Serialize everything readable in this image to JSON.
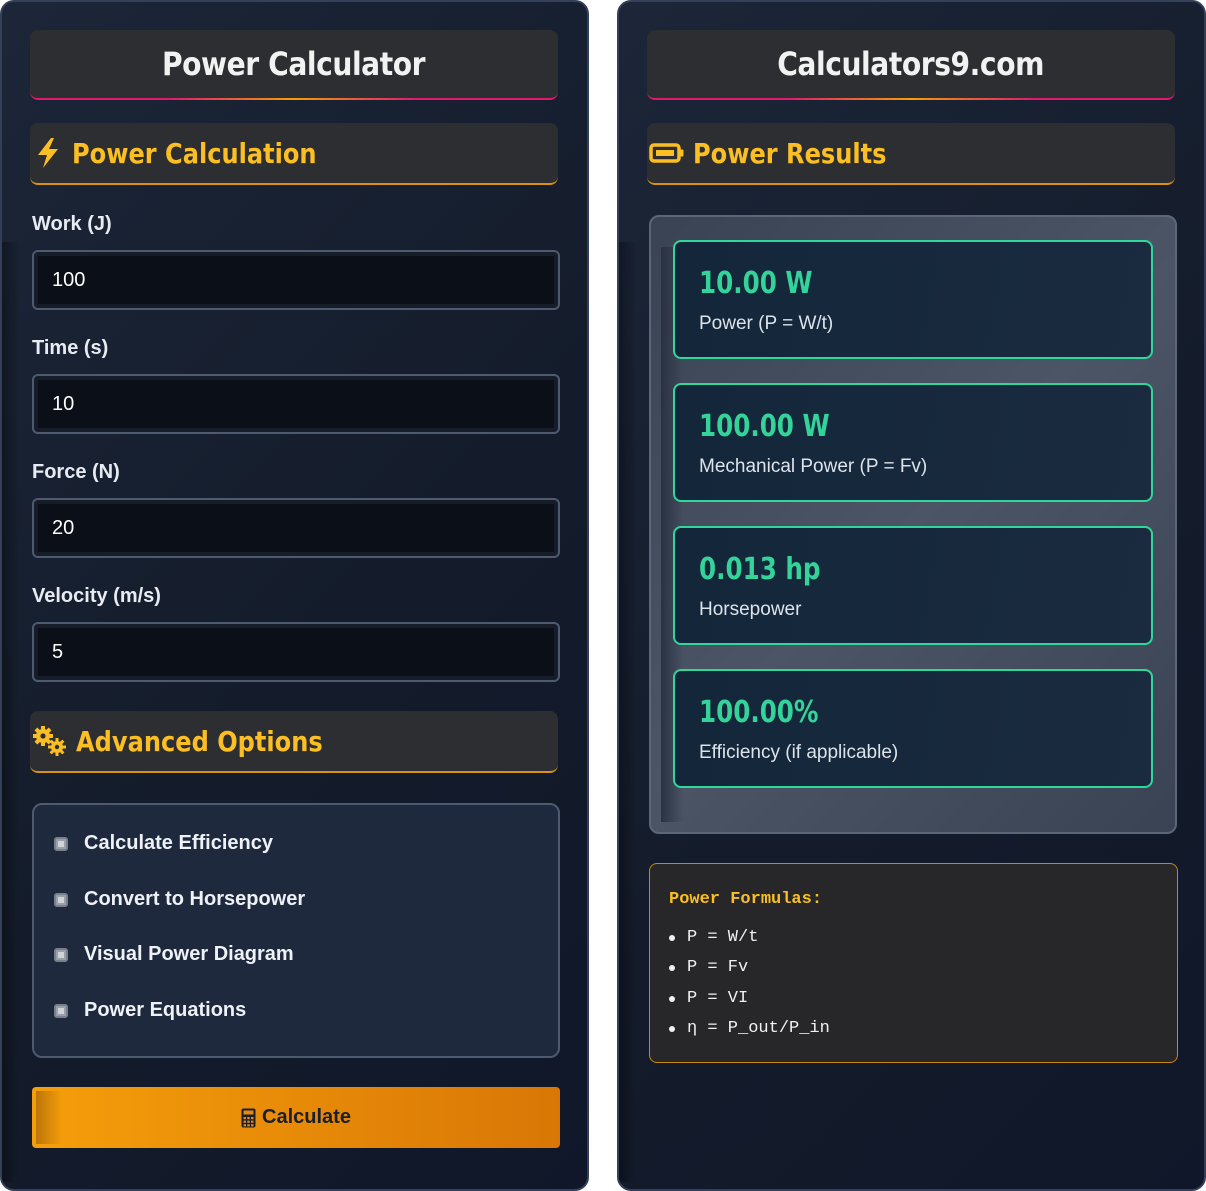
{
  "left": {
    "title": "Power Calculator",
    "calc_section": {
      "icon": "lightning-icon",
      "label": "Power Calculation"
    },
    "fields": [
      {
        "label": "Work (J)",
        "value": "100"
      },
      {
        "label": "Time (s)",
        "value": "10"
      },
      {
        "label": "Force (N)",
        "value": "20"
      },
      {
        "label": "Velocity (m/s)",
        "value": "5"
      }
    ],
    "advanced_section": {
      "icon": "gears-icon",
      "label": "Advanced Options"
    },
    "options": [
      {
        "label": "Calculate Efficiency"
      },
      {
        "label": "Convert to Horsepower"
      },
      {
        "label": "Visual Power Diagram"
      },
      {
        "label": "Power Equations"
      }
    ],
    "calculate_button": {
      "icon": "calculator-icon",
      "label": "Calculate"
    }
  },
  "right": {
    "title": "Calculators9.com",
    "results_section": {
      "icon": "battery-icon",
      "label": "Power Results"
    },
    "results": [
      {
        "value": "10.00 W",
        "label": "Power (P = W/t)"
      },
      {
        "value": "100.00 W",
        "label": "Mechanical Power (P = Fv)"
      },
      {
        "value": "0.013 hp",
        "label": "Horsepower"
      },
      {
        "value": "100.00%",
        "label": "Efficiency (if applicable)"
      }
    ],
    "formulas": {
      "title": "Power Formulas:",
      "items": [
        "P = W/t",
        "P = Fv",
        "P = VI",
        "η = P_out/P_in"
      ]
    }
  },
  "colors": {
    "accent_yellow": "#fbbf24",
    "accent_orange": "#f59e0b",
    "accent_pink": "#e2186f",
    "result_green": "#34d399",
    "panel_bg": "#1c2638"
  }
}
